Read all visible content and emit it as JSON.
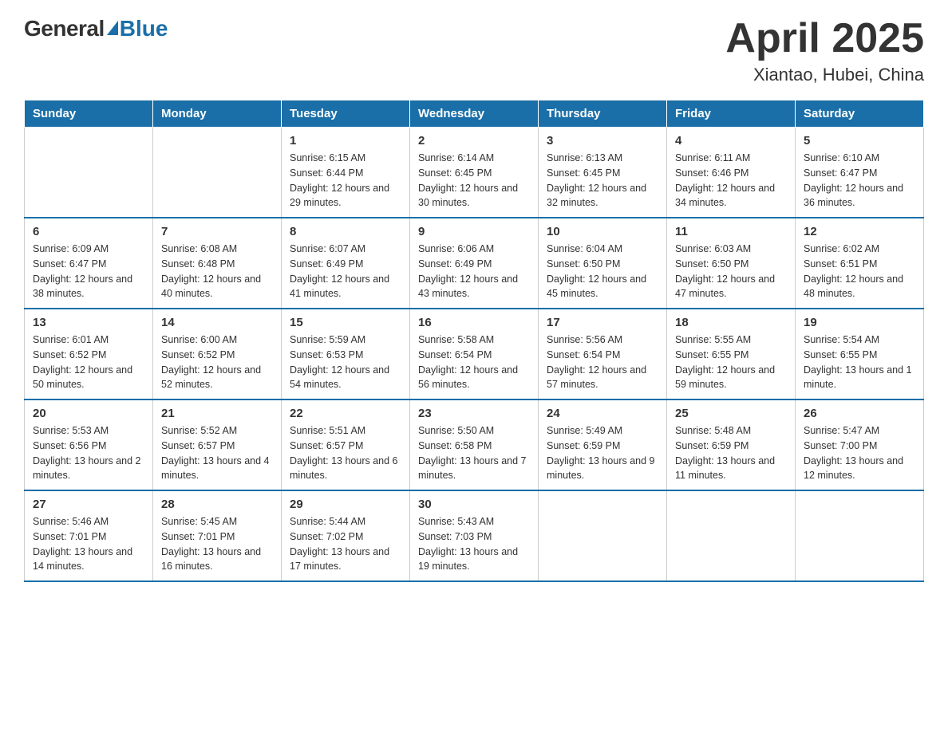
{
  "header": {
    "title": "April 2025",
    "subtitle": "Xiantao, Hubei, China",
    "logo_general": "General",
    "logo_blue": "Blue"
  },
  "weekdays": [
    "Sunday",
    "Monday",
    "Tuesday",
    "Wednesday",
    "Thursday",
    "Friday",
    "Saturday"
  ],
  "weeks": [
    [
      {
        "day": "",
        "sunrise": "",
        "sunset": "",
        "daylight": ""
      },
      {
        "day": "",
        "sunrise": "",
        "sunset": "",
        "daylight": ""
      },
      {
        "day": "1",
        "sunrise": "Sunrise: 6:15 AM",
        "sunset": "Sunset: 6:44 PM",
        "daylight": "Daylight: 12 hours and 29 minutes."
      },
      {
        "day": "2",
        "sunrise": "Sunrise: 6:14 AM",
        "sunset": "Sunset: 6:45 PM",
        "daylight": "Daylight: 12 hours and 30 minutes."
      },
      {
        "day": "3",
        "sunrise": "Sunrise: 6:13 AM",
        "sunset": "Sunset: 6:45 PM",
        "daylight": "Daylight: 12 hours and 32 minutes."
      },
      {
        "day": "4",
        "sunrise": "Sunrise: 6:11 AM",
        "sunset": "Sunset: 6:46 PM",
        "daylight": "Daylight: 12 hours and 34 minutes."
      },
      {
        "day": "5",
        "sunrise": "Sunrise: 6:10 AM",
        "sunset": "Sunset: 6:47 PM",
        "daylight": "Daylight: 12 hours and 36 minutes."
      }
    ],
    [
      {
        "day": "6",
        "sunrise": "Sunrise: 6:09 AM",
        "sunset": "Sunset: 6:47 PM",
        "daylight": "Daylight: 12 hours and 38 minutes."
      },
      {
        "day": "7",
        "sunrise": "Sunrise: 6:08 AM",
        "sunset": "Sunset: 6:48 PM",
        "daylight": "Daylight: 12 hours and 40 minutes."
      },
      {
        "day": "8",
        "sunrise": "Sunrise: 6:07 AM",
        "sunset": "Sunset: 6:49 PM",
        "daylight": "Daylight: 12 hours and 41 minutes."
      },
      {
        "day": "9",
        "sunrise": "Sunrise: 6:06 AM",
        "sunset": "Sunset: 6:49 PM",
        "daylight": "Daylight: 12 hours and 43 minutes."
      },
      {
        "day": "10",
        "sunrise": "Sunrise: 6:04 AM",
        "sunset": "Sunset: 6:50 PM",
        "daylight": "Daylight: 12 hours and 45 minutes."
      },
      {
        "day": "11",
        "sunrise": "Sunrise: 6:03 AM",
        "sunset": "Sunset: 6:50 PM",
        "daylight": "Daylight: 12 hours and 47 minutes."
      },
      {
        "day": "12",
        "sunrise": "Sunrise: 6:02 AM",
        "sunset": "Sunset: 6:51 PM",
        "daylight": "Daylight: 12 hours and 48 minutes."
      }
    ],
    [
      {
        "day": "13",
        "sunrise": "Sunrise: 6:01 AM",
        "sunset": "Sunset: 6:52 PM",
        "daylight": "Daylight: 12 hours and 50 minutes."
      },
      {
        "day": "14",
        "sunrise": "Sunrise: 6:00 AM",
        "sunset": "Sunset: 6:52 PM",
        "daylight": "Daylight: 12 hours and 52 minutes."
      },
      {
        "day": "15",
        "sunrise": "Sunrise: 5:59 AM",
        "sunset": "Sunset: 6:53 PM",
        "daylight": "Daylight: 12 hours and 54 minutes."
      },
      {
        "day": "16",
        "sunrise": "Sunrise: 5:58 AM",
        "sunset": "Sunset: 6:54 PM",
        "daylight": "Daylight: 12 hours and 56 minutes."
      },
      {
        "day": "17",
        "sunrise": "Sunrise: 5:56 AM",
        "sunset": "Sunset: 6:54 PM",
        "daylight": "Daylight: 12 hours and 57 minutes."
      },
      {
        "day": "18",
        "sunrise": "Sunrise: 5:55 AM",
        "sunset": "Sunset: 6:55 PM",
        "daylight": "Daylight: 12 hours and 59 minutes."
      },
      {
        "day": "19",
        "sunrise": "Sunrise: 5:54 AM",
        "sunset": "Sunset: 6:55 PM",
        "daylight": "Daylight: 13 hours and 1 minute."
      }
    ],
    [
      {
        "day": "20",
        "sunrise": "Sunrise: 5:53 AM",
        "sunset": "Sunset: 6:56 PM",
        "daylight": "Daylight: 13 hours and 2 minutes."
      },
      {
        "day": "21",
        "sunrise": "Sunrise: 5:52 AM",
        "sunset": "Sunset: 6:57 PM",
        "daylight": "Daylight: 13 hours and 4 minutes."
      },
      {
        "day": "22",
        "sunrise": "Sunrise: 5:51 AM",
        "sunset": "Sunset: 6:57 PM",
        "daylight": "Daylight: 13 hours and 6 minutes."
      },
      {
        "day": "23",
        "sunrise": "Sunrise: 5:50 AM",
        "sunset": "Sunset: 6:58 PM",
        "daylight": "Daylight: 13 hours and 7 minutes."
      },
      {
        "day": "24",
        "sunrise": "Sunrise: 5:49 AM",
        "sunset": "Sunset: 6:59 PM",
        "daylight": "Daylight: 13 hours and 9 minutes."
      },
      {
        "day": "25",
        "sunrise": "Sunrise: 5:48 AM",
        "sunset": "Sunset: 6:59 PM",
        "daylight": "Daylight: 13 hours and 11 minutes."
      },
      {
        "day": "26",
        "sunrise": "Sunrise: 5:47 AM",
        "sunset": "Sunset: 7:00 PM",
        "daylight": "Daylight: 13 hours and 12 minutes."
      }
    ],
    [
      {
        "day": "27",
        "sunrise": "Sunrise: 5:46 AM",
        "sunset": "Sunset: 7:01 PM",
        "daylight": "Daylight: 13 hours and 14 minutes."
      },
      {
        "day": "28",
        "sunrise": "Sunrise: 5:45 AM",
        "sunset": "Sunset: 7:01 PM",
        "daylight": "Daylight: 13 hours and 16 minutes."
      },
      {
        "day": "29",
        "sunrise": "Sunrise: 5:44 AM",
        "sunset": "Sunset: 7:02 PM",
        "daylight": "Daylight: 13 hours and 17 minutes."
      },
      {
        "day": "30",
        "sunrise": "Sunrise: 5:43 AM",
        "sunset": "Sunset: 7:03 PM",
        "daylight": "Daylight: 13 hours and 19 minutes."
      },
      {
        "day": "",
        "sunrise": "",
        "sunset": "",
        "daylight": ""
      },
      {
        "day": "",
        "sunrise": "",
        "sunset": "",
        "daylight": ""
      },
      {
        "day": "",
        "sunrise": "",
        "sunset": "",
        "daylight": ""
      }
    ]
  ]
}
